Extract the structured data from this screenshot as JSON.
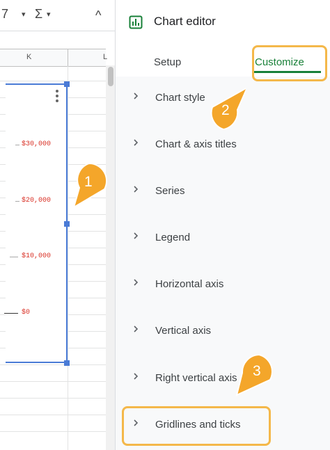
{
  "toolbar": {
    "partial_label": "7",
    "sum_symbol": "Σ",
    "dropdown_glyph": "▾",
    "collapse_glyph": "^"
  },
  "sheet": {
    "columns": [
      "K",
      "L"
    ]
  },
  "chart": {
    "y_tick_labels": [
      "$30,000",
      "$20,000",
      "$10,000",
      "$0"
    ]
  },
  "editor": {
    "title": "Chart editor",
    "tabs": [
      {
        "label": "Setup",
        "active": false
      },
      {
        "label": "Customize",
        "active": true
      }
    ],
    "sections": [
      {
        "label": "Chart style"
      },
      {
        "label": "Chart & axis titles"
      },
      {
        "label": "Series"
      },
      {
        "label": "Legend"
      },
      {
        "label": "Horizontal axis"
      },
      {
        "label": "Vertical axis"
      },
      {
        "label": "Right vertical axis"
      },
      {
        "label": "Gridlines and ticks"
      }
    ]
  },
  "callouts": [
    "1",
    "2",
    "3"
  ],
  "colors": {
    "accent_green": "#188038",
    "highlight_orange": "#f4b84a",
    "callout_fill": "#f4a62a",
    "chart_blue": "#4a7bd6",
    "axis_label_red": "#d93025"
  }
}
